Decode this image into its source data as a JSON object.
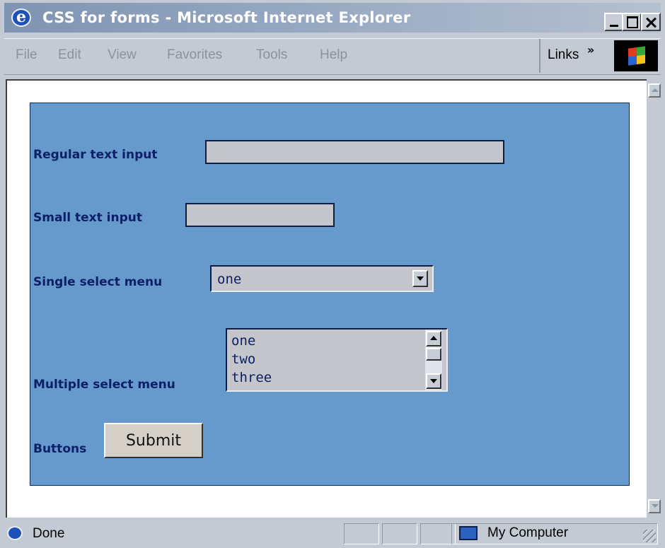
{
  "window": {
    "title": "CSS for forms - Microsoft Internet Explorer"
  },
  "menu": {
    "file": "File",
    "edit": "Edit",
    "view": "View",
    "favorites": "Favorites",
    "tools": "Tools",
    "help": "Help",
    "links": "Links",
    "links_chevron": "»"
  },
  "form": {
    "regular_label": "Regular text input",
    "regular_value": "",
    "small_label": "Small text input",
    "small_value": "",
    "single_label": "Single select menu",
    "single_selected": "one",
    "multi_label": "Multiple select menu",
    "multi_options": [
      "one",
      "two",
      "three"
    ],
    "buttons_label": "Buttons",
    "submit_label": "Submit"
  },
  "status": {
    "text": "Done",
    "zone": "My Computer"
  },
  "colors": {
    "panel_bg": "#6699cc",
    "label_text": "#0b1f66",
    "field_bg": "#c4c6cc",
    "field_border": "#0e1d46"
  },
  "icons": {
    "app": "ie-logo-icon",
    "throbber": "windows-logo-icon",
    "status": "ie-page-icon",
    "zone": "my-computer-icon"
  }
}
